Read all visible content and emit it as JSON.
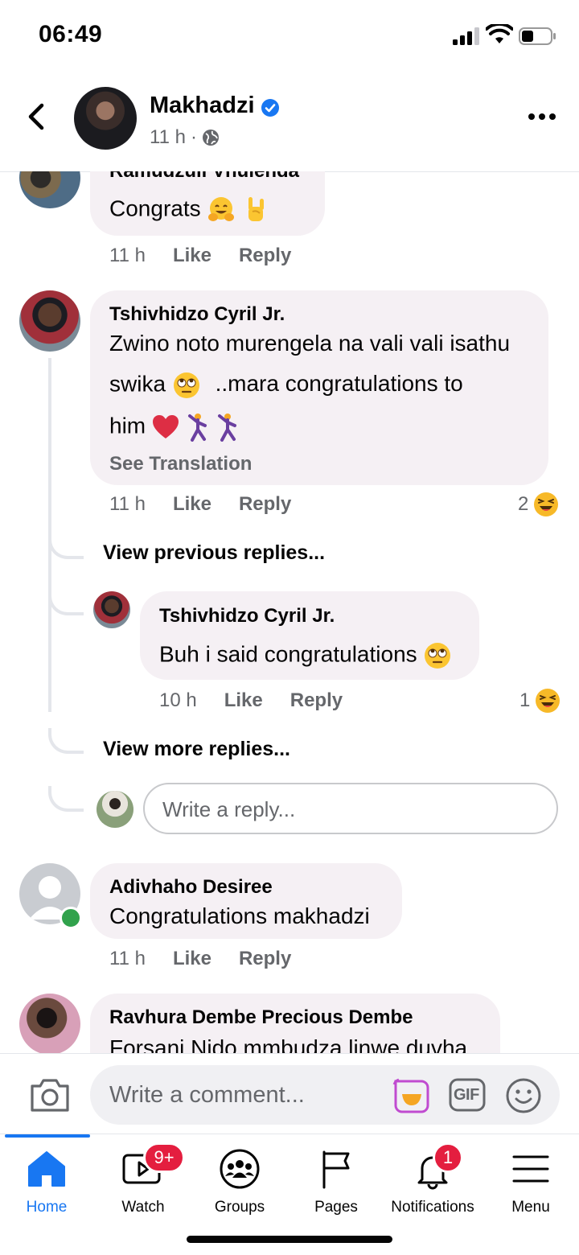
{
  "status_bar": {
    "time": "06:49"
  },
  "header": {
    "page_name": "Makhadzi",
    "time": "11 h",
    "separator": "·"
  },
  "comments": [
    {
      "author": "Ramudzuli Vhulenda",
      "text": "Congrats",
      "emojis": [
        "hugging-face",
        "sign-of-the-horns"
      ],
      "time": "11 h",
      "like": "Like",
      "reply": "Reply"
    },
    {
      "author": "Tshivhidzo Cyril Jr.",
      "lines": [
        "Zwino noto murengela na vali vali isathu",
        "swika",
        "..mara congratulations to",
        "him"
      ],
      "see_translation": "See Translation",
      "time": "11 h",
      "like": "Like",
      "reply": "Reply",
      "reaction_count": "2"
    },
    {
      "author": "Adivhaho Desiree",
      "text": "Congratulations makhadzi",
      "time": "11 h",
      "like": "Like",
      "reply": "Reply"
    },
    {
      "author": "Ravhura Dembe Precious Dembe",
      "text": "Forsani Nido mmbudza linwe duvha"
    }
  ],
  "thread": {
    "view_previous": "View previous replies...",
    "view_more": "View more replies...",
    "reply": {
      "author": "Tshivhidzo Cyril Jr.",
      "text": "Buh i said congratulations",
      "time": "10 h",
      "like": "Like",
      "reply": "Reply",
      "reaction_count": "1"
    },
    "reply_placeholder": "Write a reply..."
  },
  "composer": {
    "placeholder": "Write a comment...",
    "gif_label": "GIF"
  },
  "nav": {
    "active": "Home",
    "tabs": [
      {
        "label": "Home",
        "icon": "home-icon"
      },
      {
        "label": "Watch",
        "icon": "watch-icon",
        "badge": "9+"
      },
      {
        "label": "Groups",
        "icon": "groups-icon"
      },
      {
        "label": "Pages",
        "icon": "flag-icon"
      },
      {
        "label": "Notifications",
        "icon": "bell-icon",
        "badge": "1"
      },
      {
        "label": "Menu",
        "icon": "menu-icon"
      }
    ]
  },
  "colors": {
    "accent": "#1877f2",
    "badge": "#e41e3f",
    "bubble": "#f5f0f4",
    "online": "#31a24c"
  }
}
